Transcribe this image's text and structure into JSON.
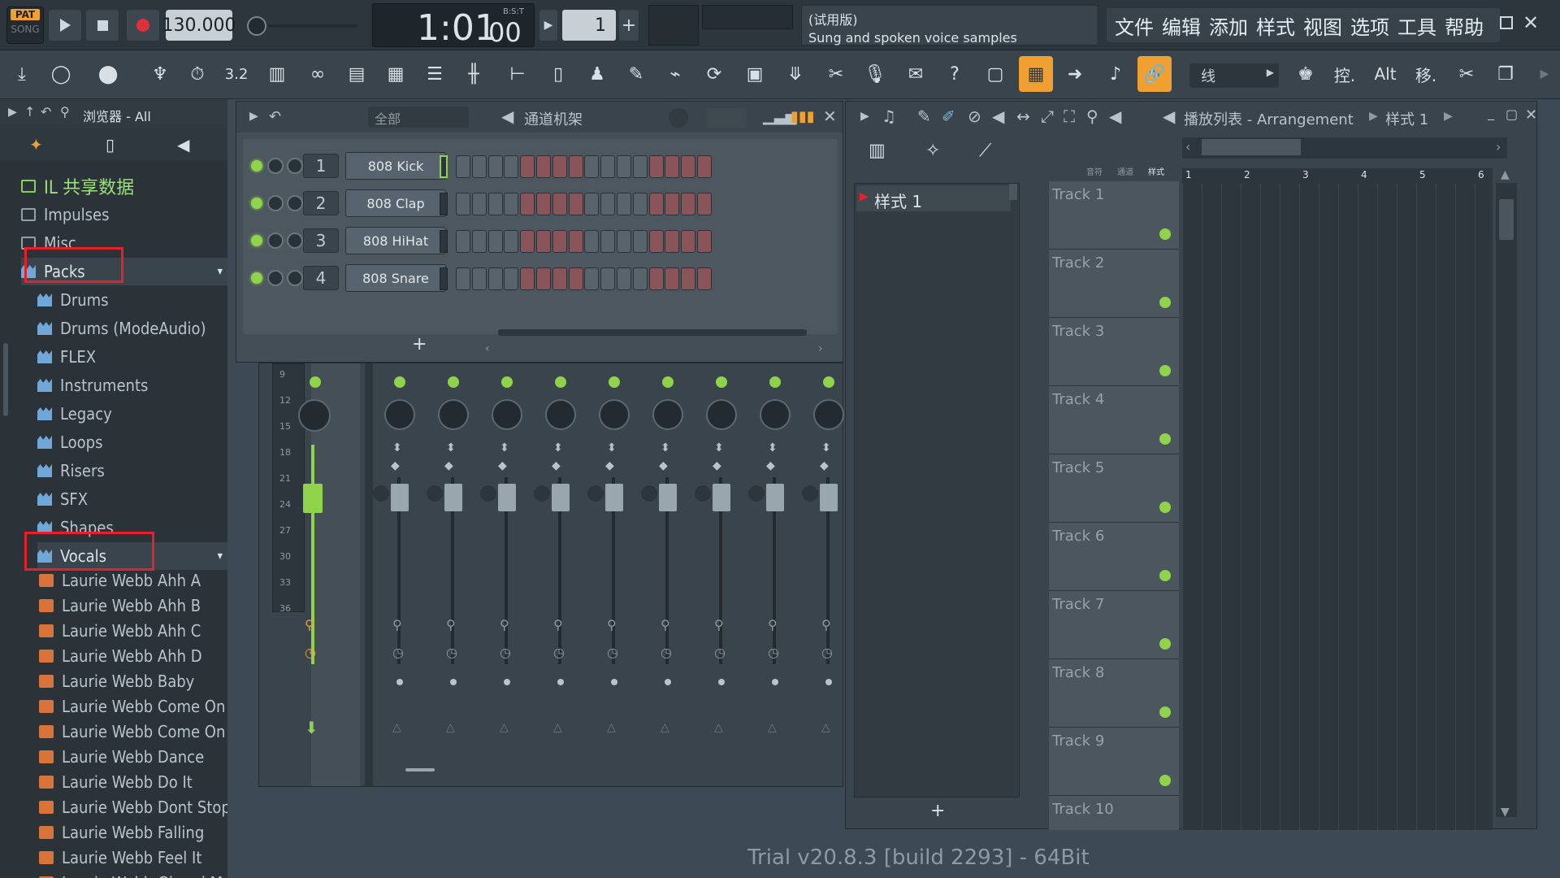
{
  "transport": {
    "pat_label": "PAT",
    "song_label": "SONG",
    "tempo": "130.000",
    "time_display": "1:01",
    "time_small": "00",
    "time_unit": "B:S:T",
    "pattern_number": "1",
    "hint_title": "(试用版)",
    "hint_text": "Sung and spoken voice samples"
  },
  "menu": [
    "文件",
    "编辑",
    "添加",
    "样式",
    "视图",
    "选项",
    "工具",
    "帮助"
  ],
  "toolbar": {
    "snap_label": "线",
    "text_buttons": [
      "控.",
      "Alt",
      "移."
    ]
  },
  "browser": {
    "title": "浏览器 - All",
    "items": [
      {
        "label": "IL 共享数据",
        "type": "shared"
      },
      {
        "label": "Impulses",
        "type": "folder"
      },
      {
        "label": "Misc",
        "type": "folder"
      },
      {
        "label": "Packs",
        "type": "pack"
      },
      {
        "label": "Drums",
        "type": "pack"
      },
      {
        "label": "Drums (ModeAudio)",
        "type": "pack"
      },
      {
        "label": "FLEX",
        "type": "pack"
      },
      {
        "label": "Instruments",
        "type": "pack"
      },
      {
        "label": "Legacy",
        "type": "pack"
      },
      {
        "label": "Loops",
        "type": "pack"
      },
      {
        "label": "Risers",
        "type": "pack"
      },
      {
        "label": "SFX",
        "type": "pack"
      },
      {
        "label": "Shapes",
        "type": "pack"
      },
      {
        "label": "Vocals",
        "type": "pack"
      },
      {
        "label": "Laurie Webb Ahh A",
        "type": "file"
      },
      {
        "label": "Laurie Webb Ahh B",
        "type": "file"
      },
      {
        "label": "Laurie Webb Ahh C",
        "type": "file"
      },
      {
        "label": "Laurie Webb Ahh D",
        "type": "file"
      },
      {
        "label": "Laurie Webb Baby",
        "type": "file"
      },
      {
        "label": "Laurie Webb Come On A",
        "type": "file"
      },
      {
        "label": "Laurie Webb Come On B",
        "type": "file"
      },
      {
        "label": "Laurie Webb Dance",
        "type": "file"
      },
      {
        "label": "Laurie Webb Do It",
        "type": "file"
      },
      {
        "label": "Laurie Webb Dont Stop",
        "type": "file"
      },
      {
        "label": "Laurie Webb Falling",
        "type": "file"
      },
      {
        "label": "Laurie Webb Feel It",
        "type": "file"
      },
      {
        "label": "Laurie Webb Gimmi More",
        "type": "file"
      }
    ]
  },
  "channel_rack": {
    "filter": "全部",
    "title": "通道机架",
    "channels": [
      {
        "num": "1",
        "name": "808 Kick"
      },
      {
        "num": "2",
        "name": "808 Clap"
      },
      {
        "num": "3",
        "name": "808 HiHat"
      },
      {
        "num": "4",
        "name": "808 Snare"
      }
    ],
    "add_label": "+"
  },
  "mixer": {
    "scale": [
      "9",
      "12",
      "15",
      "18",
      "21",
      "24",
      "27",
      "30",
      "33",
      "36"
    ]
  },
  "playlist": {
    "title": "播放列表 - Arrangement",
    "pattern_crumb": "样式 1",
    "pattern_item": "样式 1",
    "add_label": "+",
    "mini_labels": [
      "音符",
      "通道",
      "样式"
    ],
    "bar_numbers": [
      "1",
      "2",
      "3",
      "4",
      "5",
      "6"
    ],
    "tracks": [
      "Track 1",
      "Track 2",
      "Track 3",
      "Track 4",
      "Track 5",
      "Track 6",
      "Track 7",
      "Track 8",
      "Track 9",
      "Track 10"
    ]
  },
  "footer": "Trial v20.8.3 [build 2293] - 64Bit",
  "colors": {
    "accent": "#8ed34a",
    "highlight": "#e8202a",
    "orange": "#f0a030"
  }
}
